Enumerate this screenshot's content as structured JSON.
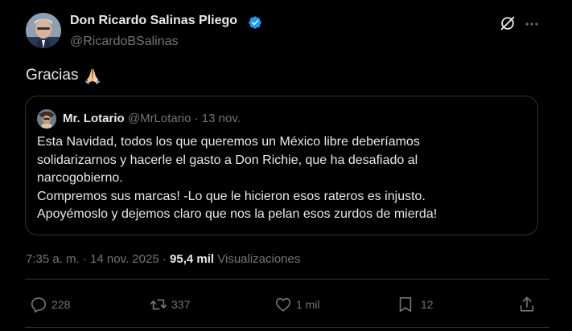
{
  "tweet": {
    "author": {
      "name": "Don Ricardo Salinas Pliego",
      "handle": "@RicardoBSalinas",
      "verified_icon": "verified-badge-icon",
      "verified_color": "#1d9bf0"
    },
    "text": "Gracias",
    "emoji_icon": "folded-hands-icon",
    "quote": {
      "name": "Mr. Lotario",
      "handle": "@MrLotario",
      "separator": "·",
      "date": "13 nov.",
      "lines": [
        "Esta Navidad, todos los que queremos un México libre deberíamos",
        "solidarizarnos y hacerle el gasto a Don Richie, que ha desafiado al",
        "narcogobierno.",
        "Compremos sus marcas! -Lo que le hicieron esos rateros es injusto.",
        "Apoyémoslo y dejemos claro que nos la pelan esos zurdos de mierda!"
      ]
    },
    "meta": {
      "time": "7:35 a. m.",
      "separator": "·",
      "date": "14 nov. 2025",
      "views_count": "95,4 mil",
      "views_label": "Visualizaciones"
    },
    "actions": {
      "replies": "228",
      "reposts": "337",
      "likes": "1 mil",
      "bookmarks": "12"
    }
  },
  "colors": {
    "background": "#000000",
    "text_primary": "#e7e9ea",
    "text_secondary": "#71767b",
    "border": "#2f3336"
  }
}
